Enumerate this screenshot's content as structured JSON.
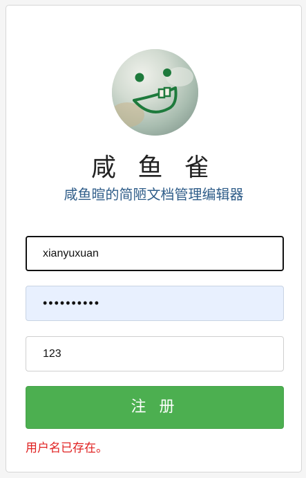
{
  "app": {
    "title": "咸 鱼 雀",
    "subtitle": "咸鱼暄的简陋文档管理编辑器"
  },
  "form": {
    "username_value": "xianyuxuan",
    "password_value": "••••••••••",
    "third_field_value": "123",
    "register_label": "注 册",
    "error_message": "用户名已存在。"
  },
  "colors": {
    "button": "#4caf50",
    "subtitle": "#2f5d89",
    "error": "#e02020",
    "autofill_bg": "#e8f0fe"
  },
  "icons": {
    "avatar": "smiley-face-avatar"
  }
}
